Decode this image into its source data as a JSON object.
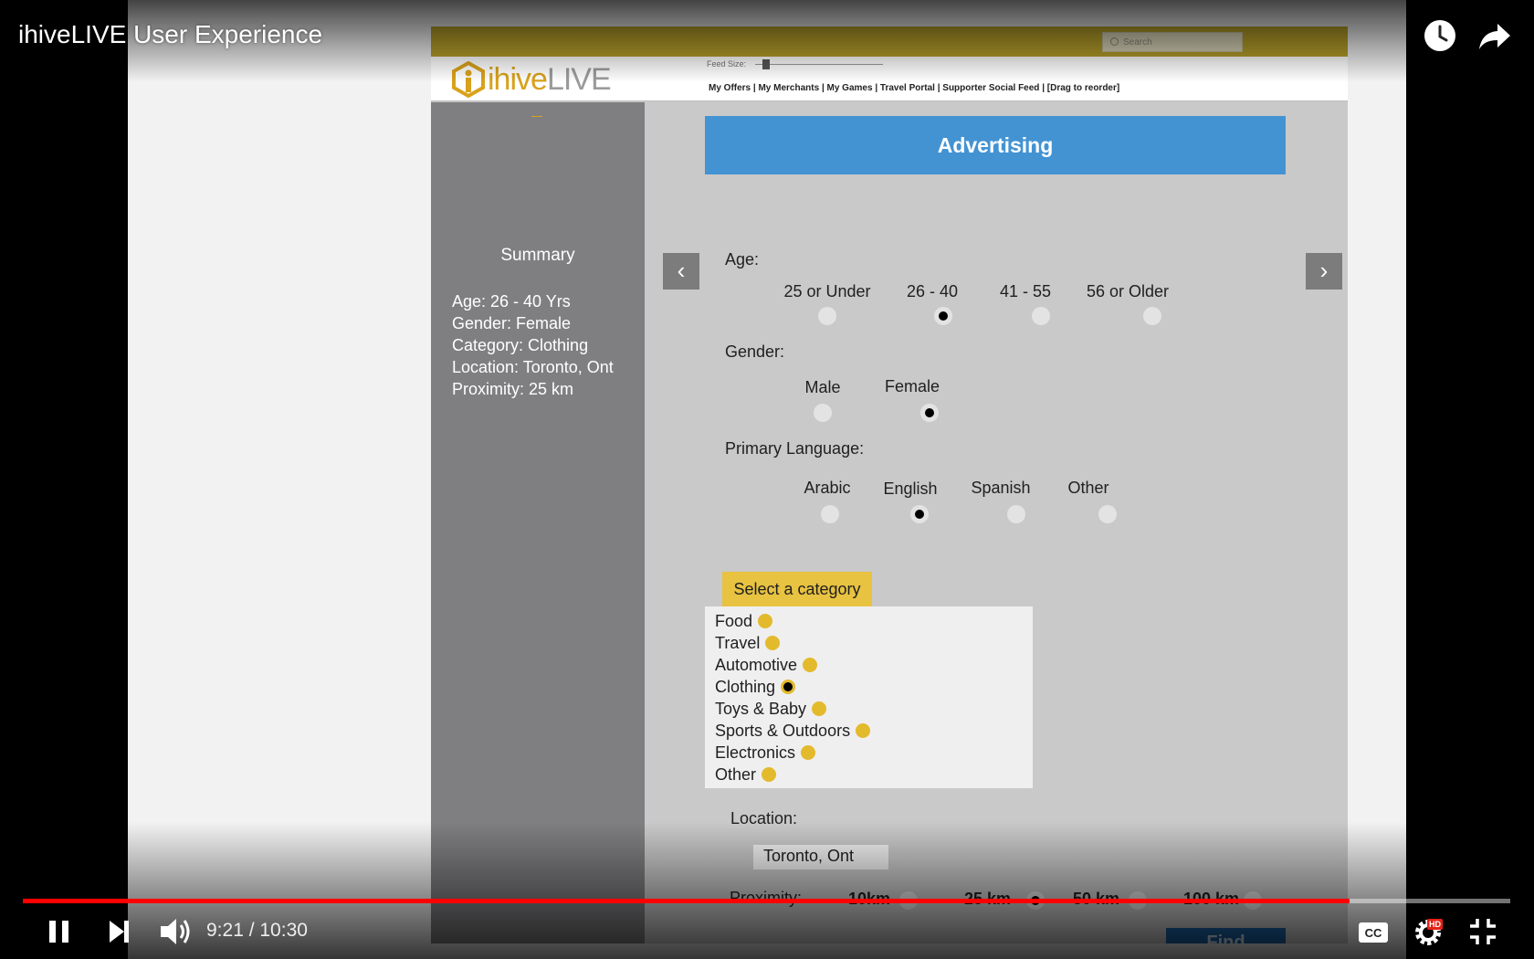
{
  "video": {
    "title": "ihiveLIVE User Experience",
    "current_time": "9:21",
    "separator": "/",
    "duration": "10:30",
    "time_display": "9:21 / 10:30",
    "progress_fraction": 0.892,
    "quality_badge": "HD",
    "icons": {
      "watch_later": "clock-icon",
      "share": "share-icon",
      "pause": "pause-icon",
      "next": "next-icon",
      "volume": "volume-icon",
      "captions": "cc-icon",
      "settings": "gear-icon",
      "exit_fullscreen": "exit-fullscreen-icon"
    },
    "colors": {
      "progress": "#ff0000",
      "hd_badge": "#e62117"
    }
  },
  "mockup": {
    "search_placeholder": "Search",
    "feed_size_label": "Feed Size:",
    "logo": {
      "i_part": "ihive",
      "live_part": "LIVE"
    },
    "nav_text": "My Offers | My Merchants | My Games | Travel Portal | Supporter Social Feed | [Drag to reorder]",
    "colors": {
      "top_bar": "#b7a02a",
      "banner": "#4393d3",
      "sidebar": "#7f7f82",
      "accent": "#e3ba2c",
      "find_button": "#1b63a6"
    },
    "summary": {
      "title": "Summary",
      "age": "Age: 26 - 40 Yrs",
      "gender": "Gender: Female",
      "category": "Category: Clothing",
      "location": "Location: Toronto, Ont",
      "proximity": "Proximity: 25 km"
    },
    "banner_title": "Advertising",
    "age": {
      "label": "Age:",
      "options": [
        "25 or Under",
        "26 - 40",
        "41 - 55",
        "56 or Older"
      ],
      "selected": "26 - 40"
    },
    "gender": {
      "label": "Gender:",
      "options": [
        "Male",
        "Female"
      ],
      "selected": "Female"
    },
    "language": {
      "label": "Primary Language:",
      "options": [
        "Arabic",
        "English",
        "Spanish",
        "Other"
      ],
      "selected": "English"
    },
    "category": {
      "header": "Select a category",
      "items": [
        "Food",
        "Travel",
        "Automotive",
        "Clothing",
        "Toys & Baby",
        "Sports & Outdoors",
        "Electronics",
        "Other"
      ],
      "selected": "Clothing"
    },
    "location": {
      "label": "Location:",
      "value": "Toronto, Ont"
    },
    "proximity": {
      "label": "Proximity:",
      "options": [
        "10km",
        "25 km",
        "50 km",
        "100 km"
      ],
      "selected": "25 km"
    },
    "find_label": "Find"
  }
}
